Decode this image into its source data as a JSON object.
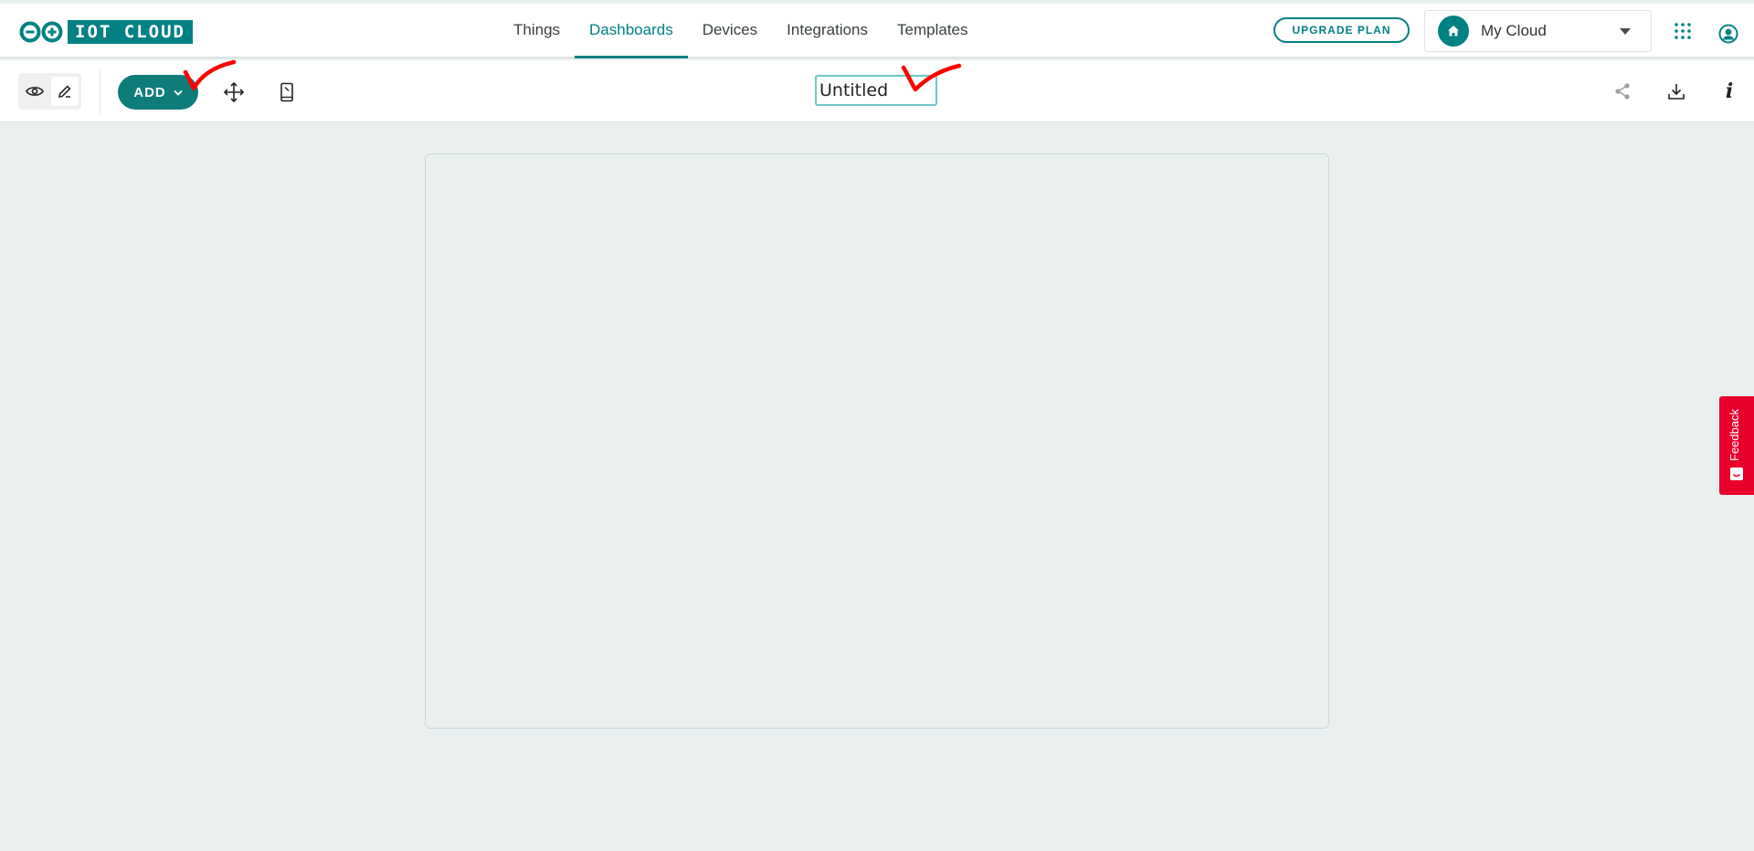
{
  "header": {
    "logo_text": "IOT CLOUD",
    "nav": [
      {
        "label": "Things",
        "active": false
      },
      {
        "label": "Dashboards",
        "active": true
      },
      {
        "label": "Devices",
        "active": false
      },
      {
        "label": "Integrations",
        "active": false
      },
      {
        "label": "Templates",
        "active": false
      }
    ],
    "upgrade_label": "UPGRADE PLAN",
    "space_label": "My Cloud"
  },
  "toolbar": {
    "add_label": "ADD",
    "dashboard_name": "Untitled"
  },
  "feedback_label": "Feedback",
  "colors": {
    "accent": "#008184",
    "background": "#e9efef",
    "feedback": "#e8002a",
    "annotation": "#ff0000"
  },
  "icons": [
    "arduino-logo-icon",
    "home-icon",
    "chevron-down-icon",
    "apps-grid-icon",
    "user-profile-icon",
    "eye-icon",
    "pencil-icon",
    "move-arrows-icon",
    "mobile-icon",
    "share-icon",
    "download-icon",
    "info-icon",
    "feedback-icon",
    "red-checkmark-annotation"
  ]
}
